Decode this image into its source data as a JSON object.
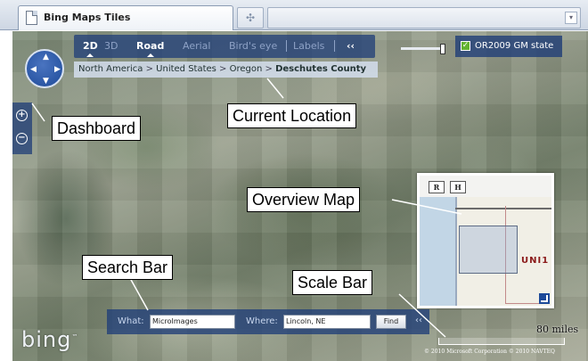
{
  "browser": {
    "tab_title": "Bing Maps Tiles",
    "new_tab_glyph": "✣",
    "tab_menu_glyph": "▾",
    "favicon_icon": "page-icon"
  },
  "toolbar": {
    "mode_2d": "2D",
    "mode_3d": "3D",
    "road": "Road",
    "aerial": "Aerial",
    "birds_eye": "Bird's eye",
    "labels": "Labels",
    "collapse": "‹‹"
  },
  "breadcrumb": {
    "items": [
      "North America",
      "United States",
      "Oregon"
    ],
    "current": "Deschutes County",
    "separator": " > "
  },
  "layer": {
    "checked": true,
    "label": "OR2009 GM state"
  },
  "zoom": {
    "in_glyph": "+",
    "out_glyph": "−",
    "slider_level": 0.95
  },
  "overview": {
    "btn_r": "R",
    "btn_h": "H",
    "country_label": "UNI1"
  },
  "search": {
    "what_label": "What:",
    "what_value": "MicroImages",
    "where_label": "Where:",
    "where_value": "Lincoln, NE",
    "find_label": "Find",
    "collapse": "‹‹"
  },
  "branding": {
    "logo_text": "bing"
  },
  "scale": {
    "label": "80 miles"
  },
  "copyright": {
    "text": "© 2010 Microsoft Corporation   © 2010 NAVTEQ"
  },
  "callouts": {
    "dashboard": "Dashboard",
    "current_location": "Current Location",
    "overview_map": "Overview Map",
    "search_bar": "Search Bar",
    "scale_bar": "Scale Bar"
  },
  "colors": {
    "panel_blue": "#224078",
    "accent_green": "#63b330",
    "overview_country": "#8b1a1a"
  }
}
